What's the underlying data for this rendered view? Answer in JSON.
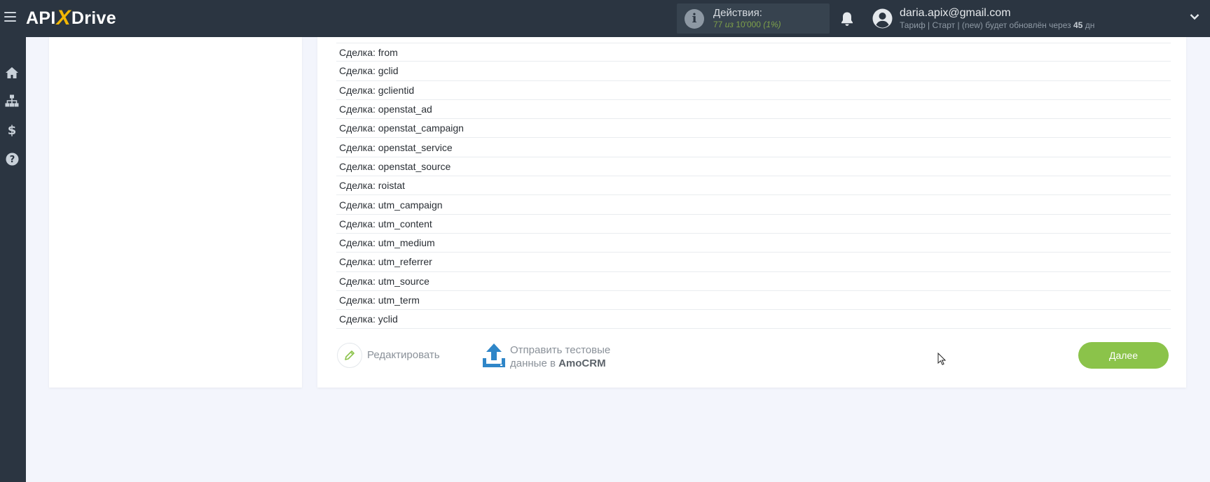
{
  "header": {
    "logo_left": "API",
    "logo_x": "X",
    "logo_right": "Drive",
    "actions_title": "Действия:",
    "actions_used": "77",
    "actions_of": "из",
    "actions_total": "10'000",
    "actions_percent": "(1%)",
    "user_email": "daria.apix@gmail.com",
    "plan_prefix": "Тариф | Старт | (new) будет обновлён через",
    "plan_days": "45",
    "plan_days_unit": "дн"
  },
  "sidebar": {
    "icons": [
      "home-icon",
      "sitemap-icon",
      "dollar-icon",
      "help-icon"
    ]
  },
  "fields": [
    "Сделка: from",
    "Сделка: gclid",
    "Сделка: gclientid",
    "Сделка: openstat_ad",
    "Сделка: openstat_campaign",
    "Сделка: openstat_service",
    "Сделка: openstat_source",
    "Сделка: roistat",
    "Сделка: utm_campaign",
    "Сделка: utm_content",
    "Сделка: utm_medium",
    "Сделка: utm_referrer",
    "Сделка: utm_source",
    "Сделка: utm_term",
    "Сделка: yclid"
  ],
  "footer": {
    "edit_label": "Редактировать",
    "send_line1": "Отправить тестовые",
    "send_line2_prefix": "данные в",
    "send_line2_target": "AmoCRM",
    "next_label": "Далее"
  },
  "colors": {
    "topbar": "#2b3541",
    "accent_green": "#8bc34a",
    "logo_x": "#f2b705",
    "upload_blue": "#2f86c8",
    "page_bg": "#f3f5fc"
  }
}
